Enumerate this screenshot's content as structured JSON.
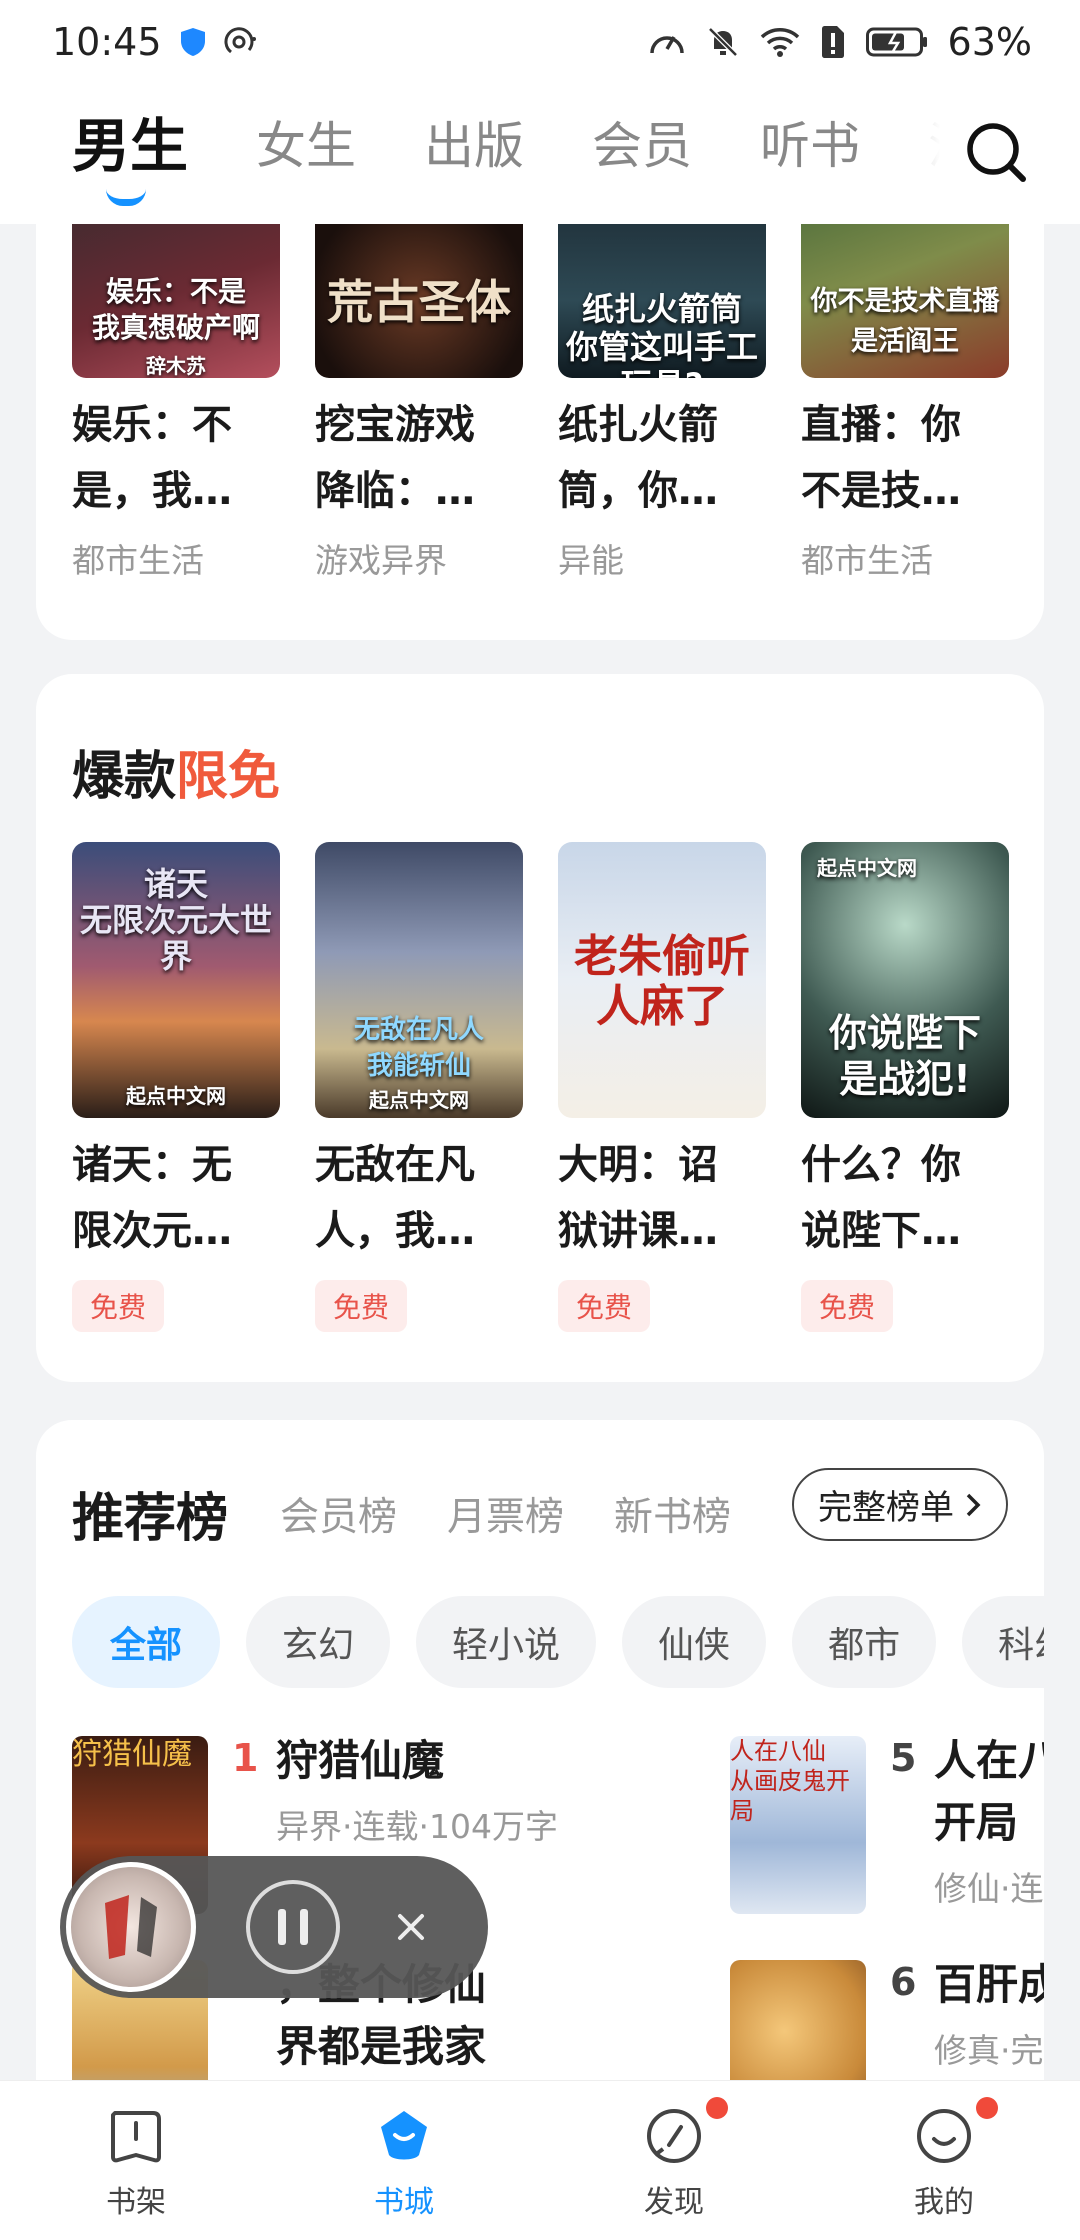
{
  "status_bar": {
    "time": "10:45",
    "battery": "63%"
  },
  "top_tabs": [
    "男生",
    "女生",
    "出版",
    "会员",
    "听书",
    "漫画"
  ],
  "featured_books": [
    {
      "title_line1": "娱乐：不",
      "title_line2": "是，我…",
      "category": "都市生活",
      "cover_text": "娱乐：不是\n我真想破产啊",
      "cover_author": "辞木苏"
    },
    {
      "title_line1": "挖宝游戏",
      "title_line2": "降临：…",
      "category": "游戏异界",
      "cover_text": "荒古圣体",
      "cover_author": ""
    },
    {
      "title_line1": "纸扎火箭",
      "title_line2": "筒，你…",
      "category": "异能",
      "cover_text": "纸扎火箭筒\n你管这叫手工玩具?",
      "cover_author": ""
    },
    {
      "title_line1": "直播：你",
      "title_line2": "不是技…",
      "category": "都市生活",
      "cover_text": "你不是技术直播\n是活阎王",
      "cover_author": ""
    }
  ],
  "free_section": {
    "title_part1": "爆款",
    "title_part2": "限免",
    "books": [
      {
        "title_line1": "诸天：无",
        "title_line2": "限次元…",
        "badge": "免费",
        "cover_text": "诸天\n无限次元大世界",
        "cover_brand": "起点中文网"
      },
      {
        "title_line1": "无敌在凡",
        "title_line2": "人，我…",
        "badge": "免费",
        "cover_text": "无敌在凡人\n我能斩仙",
        "cover_brand": "起点中文网"
      },
      {
        "title_line1": "大明：诏",
        "title_line2": "狱讲课…",
        "badge": "免费",
        "cover_text": "老朱偷听人麻了",
        "cover_brand": ""
      },
      {
        "title_line1": "什么？你",
        "title_line2": "说陛下…",
        "badge": "免费",
        "cover_text": "你说陛下\n是战犯!",
        "cover_brand": "起点中文网"
      }
    ]
  },
  "ranking": {
    "title": "推荐榜",
    "sub_tabs": [
      "会员榜",
      "月票榜",
      "新书榜"
    ],
    "full_list_label": "完整榜单",
    "chips": [
      "全部",
      "玄幻",
      "轻小说",
      "仙侠",
      "都市",
      "科幻"
    ],
    "items": [
      {
        "num": "1",
        "title": "狩猎仙魔",
        "meta": "异界·连载·104万字",
        "cover_text": "狩猎仙魔"
      },
      {
        "num": "",
        "title_line1": "，整个修仙",
        "title_line2": "界都是我家",
        "meta": ""
      },
      {
        "num": "5",
        "title_line1": "人在八",
        "title_line2": "开局",
        "meta": "修仙·连",
        "cover_text": "人在八仙\n从画皮鬼开局"
      },
      {
        "num": "6",
        "title": "百肝成",
        "meta": "修真·完"
      }
    ]
  },
  "bottom_nav": [
    {
      "label": "书架",
      "icon": "bookshelf-icon"
    },
    {
      "label": "书城",
      "icon": "bookstore-icon"
    },
    {
      "label": "发现",
      "icon": "discover-icon"
    },
    {
      "label": "我的",
      "icon": "profile-icon"
    }
  ],
  "colors": {
    "accent": "#1592ff",
    "hot": "#f05a3c",
    "badge_dot": "#f04a3a"
  }
}
